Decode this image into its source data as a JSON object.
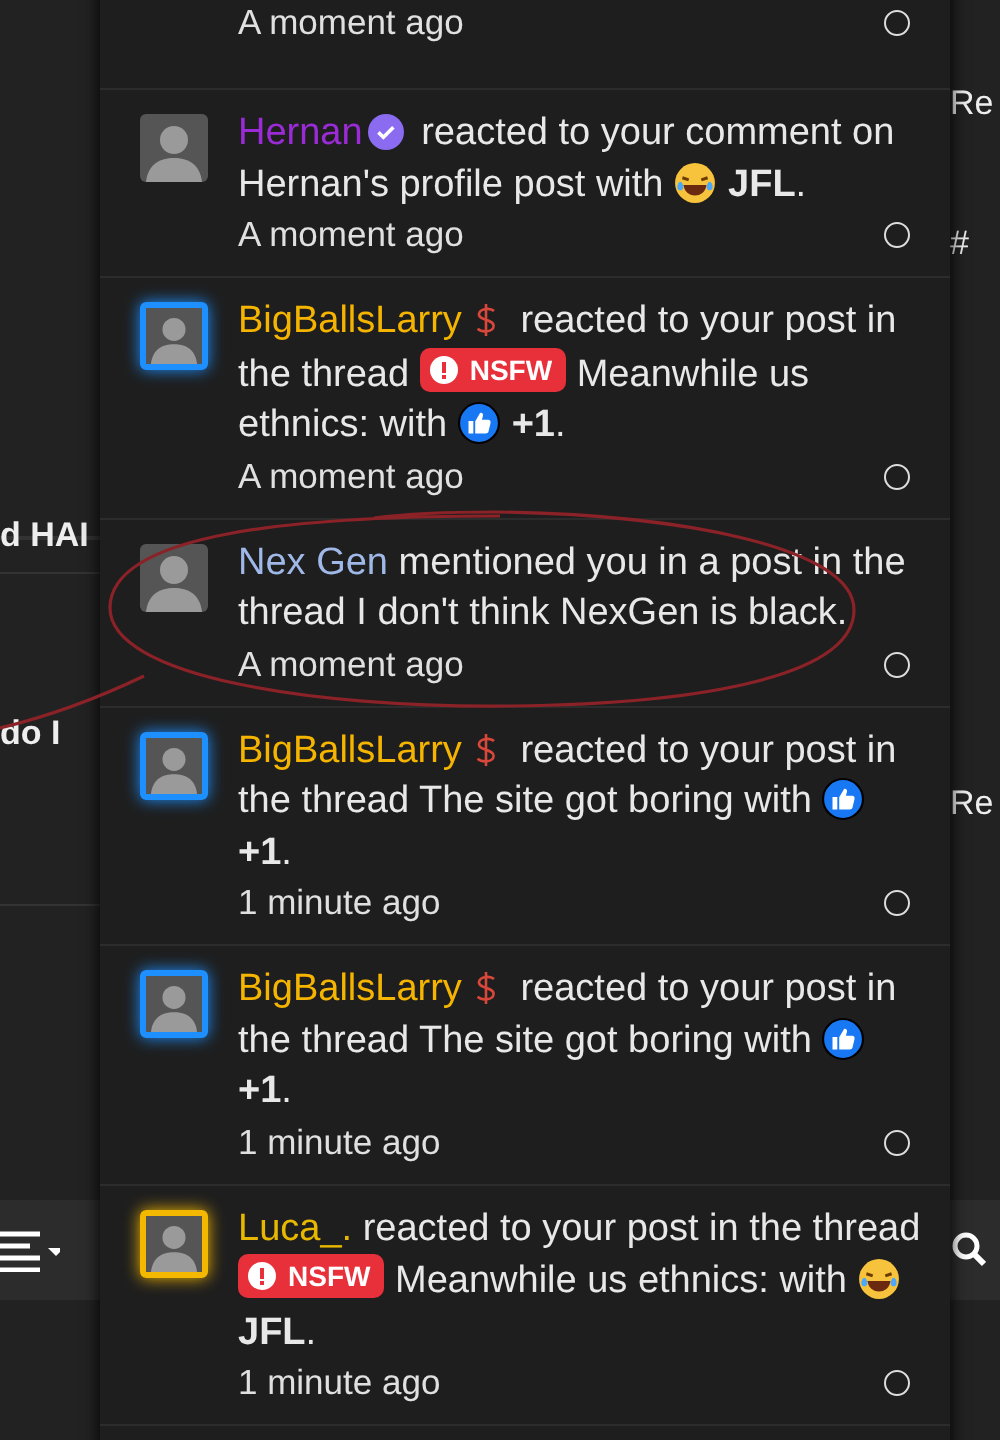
{
  "background": {
    "left_texts": [
      "d HAI",
      "do I"
    ],
    "right_texts": [
      "Re",
      "#",
      "Re"
    ]
  },
  "notifications": [
    {
      "time": "A moment ago"
    },
    {
      "username": "Hernan",
      "color": "#9b2bd6",
      "badge": {
        "kind": "verified"
      },
      "avatar": {
        "kind": "plain"
      },
      "message": [
        {
          "kind": "text",
          "text": "reacted to your comment on Hernan's profile post with"
        },
        {
          "kind": "laugh_reaction",
          "text": "JFL"
        },
        {
          "kind": "text",
          "text": "."
        }
      ],
      "time": "A moment ago"
    },
    {
      "username": "BigBallsLarry",
      "color": "#f5b400",
      "badge": {
        "kind": "dollar"
      },
      "avatar": {
        "kind": "framed",
        "color": "#1e8fff"
      },
      "message": [
        {
          "kind": "text",
          "text": "reacted to your post in the thread"
        },
        {
          "kind": "tag",
          "text": "NSFW"
        },
        {
          "kind": "text",
          "text": "Meanwhile us ethnics: with"
        },
        {
          "kind": "like_reaction",
          "text": "+1"
        },
        {
          "kind": "text",
          "text": "."
        }
      ],
      "time": "A moment ago"
    },
    {
      "username": "Nex Gen",
      "color": "#9fb8e8",
      "avatar": {
        "kind": "plain"
      },
      "message": [
        {
          "kind": "text",
          "text": "mentioned you in a post in the thread I don't think NexGen is black."
        }
      ],
      "time": "A moment ago"
    },
    {
      "username": "BigBallsLarry",
      "color": "#f5b400",
      "badge": {
        "kind": "dollar"
      },
      "avatar": {
        "kind": "framed",
        "color": "#1e8fff"
      },
      "message": [
        {
          "kind": "text",
          "text": "reacted to your post in the thread The site got boring with"
        },
        {
          "kind": "like_reaction",
          "text": "+1"
        },
        {
          "kind": "text",
          "text": "."
        }
      ],
      "time": "1 minute ago"
    },
    {
      "username": "BigBallsLarry",
      "color": "#f5b400",
      "badge": {
        "kind": "dollar"
      },
      "avatar": {
        "kind": "framed",
        "color": "#1e8fff"
      },
      "message": [
        {
          "kind": "text",
          "text": "reacted to your post in the thread The site got boring with"
        },
        {
          "kind": "like_reaction",
          "text": "+1"
        },
        {
          "kind": "text",
          "text": "."
        }
      ],
      "time": "1 minute ago"
    },
    {
      "username": "Luca_.",
      "color": "#e8b800",
      "avatar": {
        "kind": "framed",
        "color": "#f5b800"
      },
      "message": [
        {
          "kind": "text",
          "text": "reacted to your post in the thread"
        },
        {
          "kind": "tag",
          "text": "NSFW"
        },
        {
          "kind": "text",
          "text": "Meanwhile us ethnics: with"
        },
        {
          "kind": "laugh_reaction",
          "text": "JFL"
        },
        {
          "kind": "text",
          "text": "."
        }
      ],
      "time": "1 minute ago"
    }
  ]
}
